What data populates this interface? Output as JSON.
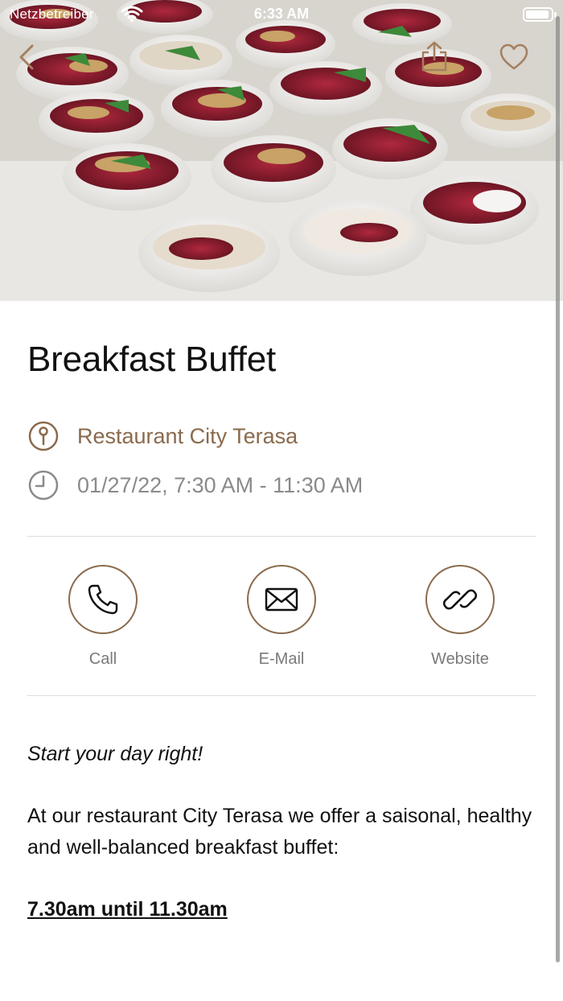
{
  "status_bar": {
    "carrier": "Netzbetreiber",
    "time": "6:33 AM",
    "wifi_icon": "wifi-icon",
    "battery_icon": "battery-icon"
  },
  "nav": {
    "back_icon": "chevron-left-icon",
    "share_icon": "share-icon",
    "favorite_icon": "heart-icon"
  },
  "hero": {
    "image_description_icon": "photo-icon"
  },
  "event": {
    "title": "Breakfast Buffet",
    "location": "Restaurant City Terasa",
    "datetime": "01/27/22, 7:30 AM - 11:30 AM"
  },
  "actions": [
    {
      "label": "Call",
      "icon": "phone-icon"
    },
    {
      "label": "E-Mail",
      "icon": "envelope-icon"
    },
    {
      "label": "Website",
      "icon": "link-icon"
    }
  ],
  "description": {
    "tagline": "Start your day right!",
    "text": "At our restaurant City Terasa we offer a saisonal, healthy and well-balanced breakfast buffet:",
    "hours": "7.30am until 11.30am"
  },
  "colors": {
    "accent": "#8a6a4c",
    "secondary_text": "#8a8a8a",
    "divider": "#dcdcdc"
  }
}
